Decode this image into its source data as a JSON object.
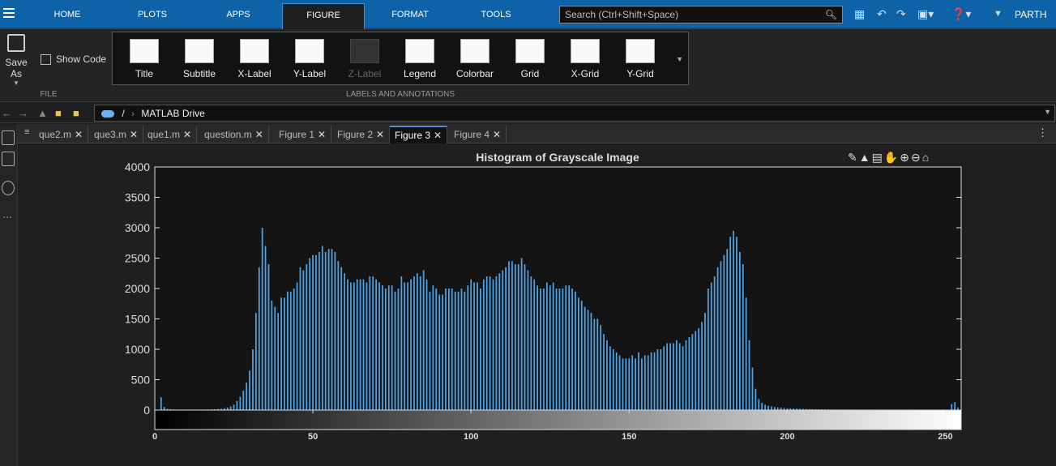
{
  "topbar": {
    "tabs": [
      "HOME",
      "PLOTS",
      "APPS",
      "FIGURE",
      "FORMAT",
      "TOOLS"
    ],
    "active_tab": "FIGURE",
    "search_placeholder": "Search (Ctrl+Shift+Space)",
    "user": "PARTH"
  },
  "ribbon": {
    "save_as": "Save As",
    "show_code": "Show Code",
    "file_group": "FILE",
    "gallery_group": "LABELS AND ANNOTATIONS",
    "gallery": [
      {
        "label": "Title",
        "enabled": true
      },
      {
        "label": "Subtitle",
        "enabled": true
      },
      {
        "label": "X-Label",
        "enabled": true
      },
      {
        "label": "Y-Label",
        "enabled": true
      },
      {
        "label": "Z-Label",
        "enabled": false
      },
      {
        "label": "Legend",
        "enabled": true
      },
      {
        "label": "Colorbar",
        "enabled": true
      },
      {
        "label": "Grid",
        "enabled": true
      },
      {
        "label": "X-Grid",
        "enabled": true
      },
      {
        "label": "Y-Grid",
        "enabled": true
      }
    ]
  },
  "address": {
    "root": "/",
    "folder": "MATLAB Drive"
  },
  "doc_tabs": [
    {
      "label": "que2.m",
      "active": false
    },
    {
      "label": "que3.m",
      "active": false
    },
    {
      "label": "que1.m",
      "active": false
    },
    {
      "label": "question.m",
      "active": false
    },
    {
      "label": "Figure 1",
      "active": false
    },
    {
      "label": "Figure 2",
      "active": false
    },
    {
      "label": "Figure 3",
      "active": true
    },
    {
      "label": "Figure 4",
      "active": false
    }
  ],
  "chart_data": {
    "type": "bar",
    "title": "Histogram of Grayscale Image",
    "xlabel": "",
    "ylabel": "",
    "xlim": [
      0,
      255
    ],
    "ylim": [
      0,
      4000
    ],
    "yticks": [
      0,
      500,
      1000,
      1500,
      2000,
      2500,
      3000,
      3500,
      4000
    ],
    "xticks": [
      0,
      50,
      100,
      150,
      200,
      250
    ],
    "x": [
      0,
      1,
      2,
      3,
      4,
      5,
      6,
      7,
      8,
      9,
      10,
      11,
      12,
      13,
      14,
      15,
      16,
      17,
      18,
      19,
      20,
      21,
      22,
      23,
      24,
      25,
      26,
      27,
      28,
      29,
      30,
      31,
      32,
      33,
      34,
      35,
      36,
      37,
      38,
      39,
      40,
      41,
      42,
      43,
      44,
      45,
      46,
      47,
      48,
      49,
      50,
      51,
      52,
      53,
      54,
      55,
      56,
      57,
      58,
      59,
      60,
      61,
      62,
      63,
      64,
      65,
      66,
      67,
      68,
      69,
      70,
      71,
      72,
      73,
      74,
      75,
      76,
      77,
      78,
      79,
      80,
      81,
      82,
      83,
      84,
      85,
      86,
      87,
      88,
      89,
      90,
      91,
      92,
      93,
      94,
      95,
      96,
      97,
      98,
      99,
      100,
      101,
      102,
      103,
      104,
      105,
      106,
      107,
      108,
      109,
      110,
      111,
      112,
      113,
      114,
      115,
      116,
      117,
      118,
      119,
      120,
      121,
      122,
      123,
      124,
      125,
      126,
      127,
      128,
      129,
      130,
      131,
      132,
      133,
      134,
      135,
      136,
      137,
      138,
      139,
      140,
      141,
      142,
      143,
      144,
      145,
      146,
      147,
      148,
      149,
      150,
      151,
      152,
      153,
      154,
      155,
      156,
      157,
      158,
      159,
      160,
      161,
      162,
      163,
      164,
      165,
      166,
      167,
      168,
      169,
      170,
      171,
      172,
      173,
      174,
      175,
      176,
      177,
      178,
      179,
      180,
      181,
      182,
      183,
      184,
      185,
      186,
      187,
      188,
      189,
      190,
      191,
      192,
      193,
      194,
      195,
      196,
      197,
      198,
      199,
      200,
      201,
      202,
      203,
      204,
      205,
      206,
      207,
      208,
      209,
      210,
      211,
      212,
      213,
      214,
      215,
      216,
      217,
      218,
      219,
      220,
      221,
      222,
      223,
      224,
      225,
      226,
      227,
      228,
      229,
      230,
      231,
      232,
      233,
      234,
      235,
      236,
      237,
      238,
      239,
      240,
      241,
      242,
      243,
      244,
      245,
      246,
      247,
      248,
      249,
      250,
      251,
      252,
      253,
      254,
      255
    ],
    "values": [
      0,
      0,
      210,
      50,
      20,
      15,
      10,
      8,
      8,
      8,
      8,
      8,
      8,
      8,
      8,
      8,
      10,
      10,
      12,
      14,
      18,
      22,
      30,
      40,
      60,
      90,
      150,
      220,
      320,
      450,
      650,
      1000,
      1600,
      2350,
      3000,
      2700,
      2400,
      1800,
      1700,
      1600,
      1850,
      1850,
      1950,
      1950,
      2000,
      2100,
      2350,
      2300,
      2400,
      2500,
      2550,
      2550,
      2600,
      2700,
      2600,
      2650,
      2650,
      2600,
      2450,
      2350,
      2250,
      2150,
      2100,
      2100,
      2150,
      2150,
      2150,
      2100,
      2200,
      2200,
      2150,
      2100,
      2050,
      2000,
      2050,
      2050,
      1950,
      2000,
      2200,
      2100,
      2100,
      2150,
      2200,
      2250,
      2200,
      2300,
      2150,
      1950,
      2050,
      2000,
      1900,
      1900,
      2000,
      2000,
      2000,
      1950,
      1950,
      2000,
      1950,
      2050,
      2150,
      2100,
      2100,
      2000,
      2150,
      2200,
      2200,
      2150,
      2200,
      2250,
      2300,
      2350,
      2450,
      2450,
      2400,
      2400,
      2500,
      2400,
      2300,
      2200,
      2150,
      2050,
      2000,
      2000,
      2100,
      2050,
      2100,
      2000,
      2000,
      2000,
      2050,
      2050,
      2000,
      1950,
      1850,
      1800,
      1700,
      1650,
      1600,
      1500,
      1500,
      1400,
      1250,
      1150,
      1050,
      1000,
      950,
      900,
      850,
      850,
      850,
      900,
      850,
      950,
      850,
      900,
      900,
      950,
      950,
      1000,
      1000,
      1050,
      1100,
      1100,
      1100,
      1150,
      1100,
      1050,
      1150,
      1200,
      1250,
      1300,
      1350,
      1450,
      1600,
      2000,
      2100,
      2200,
      2350,
      2450,
      2550,
      2650,
      2850,
      2950,
      2850,
      2600,
      2400,
      1850,
      1150,
      700,
      350,
      180,
      120,
      90,
      70,
      60,
      50,
      45,
      40,
      35,
      30,
      28,
      26,
      24,
      22,
      20,
      18,
      16,
      15,
      14,
      13,
      12,
      11,
      10,
      10,
      9,
      9,
      8,
      8,
      8,
      8,
      7,
      7,
      7,
      7,
      6,
      6,
      6,
      6,
      6,
      6,
      6,
      6,
      6,
      6,
      6,
      6,
      6,
      6,
      6,
      6,
      6,
      6,
      6,
      6,
      6,
      6,
      6,
      6,
      6,
      6,
      6,
      100,
      130,
      40
    ],
    "bar_color": "#4da3e8",
    "grid": false,
    "colorbar": "grayscale"
  }
}
